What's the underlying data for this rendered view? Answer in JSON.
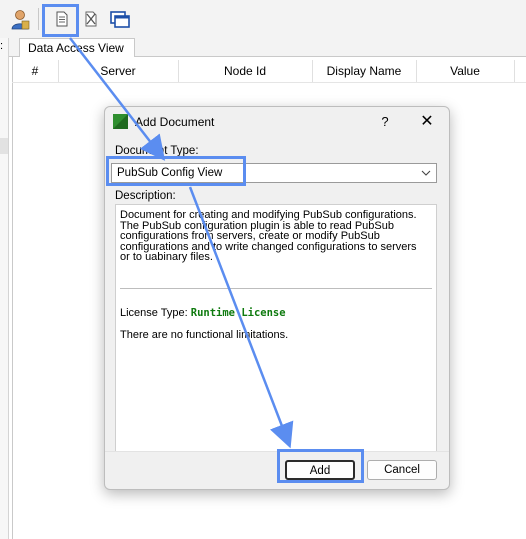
{
  "toolbar": {
    "icons": [
      "user-icon",
      "new-document-icon",
      "delete-document-icon",
      "window-icon"
    ]
  },
  "tab": {
    "label": "Data Access View"
  },
  "grid": {
    "columns": [
      "#",
      "Server",
      "Node Id",
      "Display Name",
      "Value"
    ]
  },
  "dialog": {
    "title": "Add Document",
    "help_label": "?",
    "close_label": "✕",
    "document_type_label": "Document Type:",
    "document_type_value": "PubSub Config View",
    "description_label": "Description:",
    "description_text": "Document for creating and modifying PubSub configurations.\nThe PubSub configuration plugin is able to read PubSub\nconfigurations from servers, create or modify PubSub\nconfigurations and to write changed configurations to servers\nor to uabinary files.",
    "license_label": "License Type:",
    "license_value": "Runtime License",
    "limitations_text": "There are no functional limitations.",
    "add_label": "Add",
    "cancel_label": "Cancel"
  },
  "colors": {
    "highlight": "#5b8df0",
    "license_green": "#0e7a0e"
  }
}
